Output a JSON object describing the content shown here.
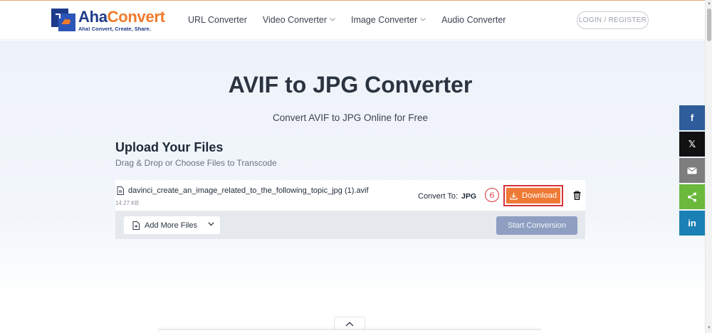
{
  "header": {
    "logo": {
      "name_part1": "Aha",
      "name_part2": "Convert",
      "tagline": "Aha! Convert, Create, Share."
    },
    "nav": [
      {
        "label": "URL Converter",
        "dropdown": false
      },
      {
        "label": "Video Converter",
        "dropdown": true
      },
      {
        "label": "Image Converter",
        "dropdown": true
      },
      {
        "label": "Audio Converter",
        "dropdown": false
      }
    ],
    "login_label": "LOGIN / REGISTER"
  },
  "hero": {
    "title": "AVIF to JPG Converter",
    "subtitle": "Convert AVIF to JPG Online for Free"
  },
  "upload": {
    "title": "Upload Your Files",
    "subtitle": "Drag & Drop or Choose Files to Transcode"
  },
  "file": {
    "name": "davinci_create_an_image_related_to_the_following_topic_jpg (1).avif",
    "size": "14.27 KB",
    "convert_label": "Convert To:",
    "convert_format": "JPG",
    "step_number": "6",
    "download_label": "Download"
  },
  "actions": {
    "add_more_label": "Add More Files",
    "start_label": "Start Conversion"
  },
  "social": [
    {
      "name": "facebook",
      "glyph": "f"
    },
    {
      "name": "x",
      "glyph": "𝕏"
    },
    {
      "name": "email",
      "glyph": ""
    },
    {
      "name": "share",
      "glyph": ""
    },
    {
      "name": "linkedin",
      "glyph": "in"
    }
  ],
  "colors": {
    "brand_blue": "#1e3a8a",
    "brand_orange": "#f07a2b",
    "download_button": "#ef7a36",
    "highlight_red": "#d4333a",
    "start_button_disabled": "#8e9fc2"
  }
}
